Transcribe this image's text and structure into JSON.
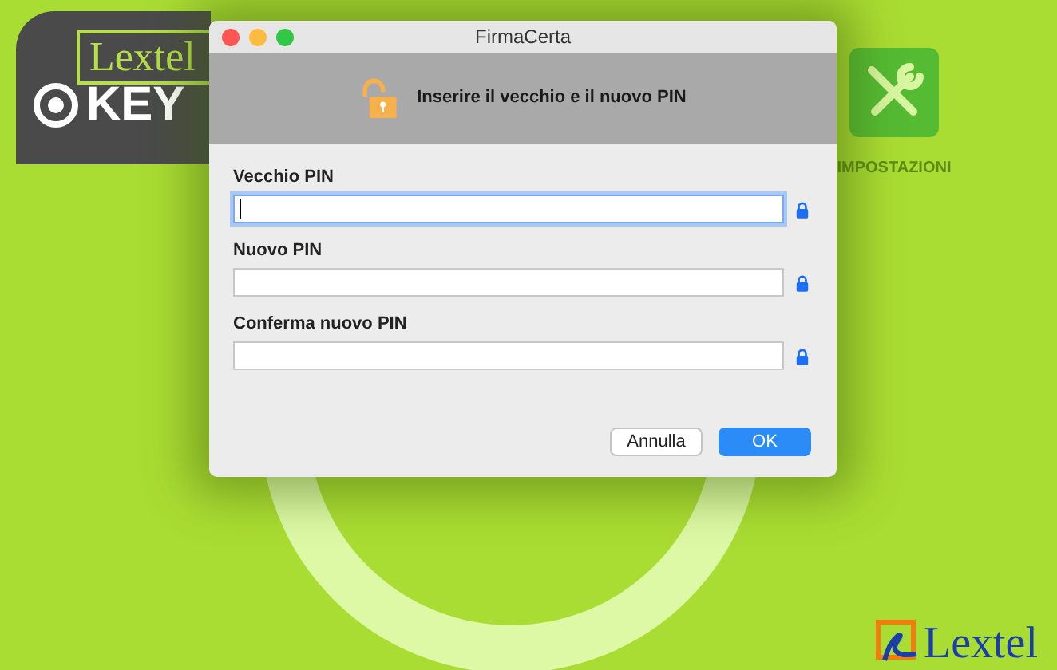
{
  "app": {
    "logo_top": "Lextel",
    "logo_key": "KEY",
    "settings_label": "IMPOSTAZIONI",
    "footer_logo": "Lextel"
  },
  "window": {
    "title": "FirmaCerta"
  },
  "header": {
    "message": "Inserire il vecchio e il nuovo PIN"
  },
  "fields": [
    {
      "label": "Vecchio PIN",
      "focused": true
    },
    {
      "label": "Nuovo PIN",
      "focused": false
    },
    {
      "label": "Conferma nuovo PIN",
      "focused": false
    }
  ],
  "buttons": [
    {
      "label": "Annulla",
      "kind": "secondary"
    },
    {
      "label": "OK",
      "kind": "primary"
    }
  ]
}
